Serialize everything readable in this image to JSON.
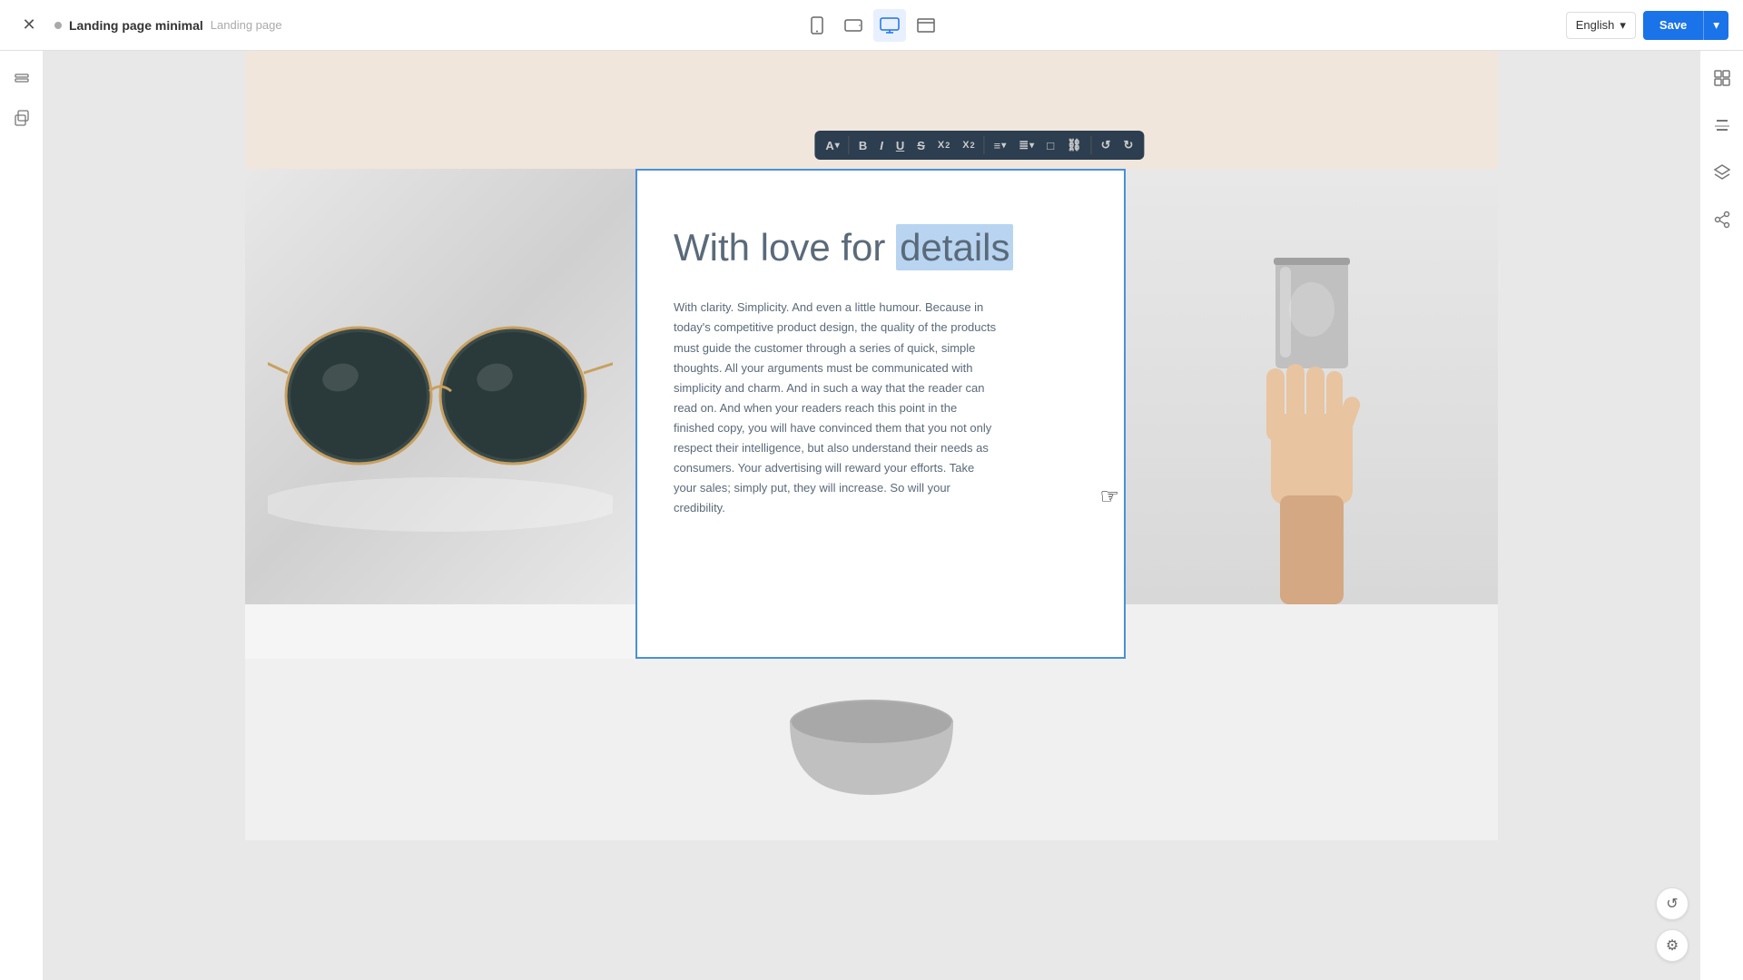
{
  "topbar": {
    "close_label": "✕",
    "page_name": "Landing page minimal",
    "page_type": "Landing page",
    "language": "English",
    "save_label": "Save",
    "devices": [
      {
        "icon": "📱",
        "label": "mobile",
        "active": false
      },
      {
        "icon": "💻",
        "label": "tablet",
        "active": false
      },
      {
        "icon": "🖥",
        "label": "desktop",
        "active": true
      },
      {
        "icon": "⊞",
        "label": "fullscreen",
        "active": false
      }
    ]
  },
  "sidebar_left": {
    "icons": [
      {
        "name": "layers-icon",
        "symbol": "⊞"
      },
      {
        "name": "copy-icon",
        "symbol": "⧉"
      }
    ]
  },
  "sidebar_right": {
    "icons": [
      {
        "name": "element-icon",
        "symbol": "◻"
      },
      {
        "name": "edit-icon",
        "symbol": "✏"
      },
      {
        "name": "layers-icon",
        "symbol": "≡"
      },
      {
        "name": "share-icon",
        "symbol": "⬡"
      }
    ]
  },
  "editor": {
    "heading": "With love for ",
    "heading_highlight": "details",
    "body_text": "With clarity. Simplicity. And even a little humour. Because in today's competitive product design, the quality of the products must guide the customer through a series of quick, simple thoughts. All your arguments must be communicated with simplicity and charm. And in such a way that the reader can read on. And when your readers reach this point in the finished copy, you will have convinced them that you not only respect their intelligence, but also understand their needs as consumers. Your advertising will reward your efforts. Take your sales; simply put, they will increase. So will your credibility."
  },
  "toolbar": {
    "font_label": "A",
    "bold_label": "B",
    "italic_label": "I",
    "underline_label": "U",
    "strikethrough_label": "S̶",
    "superscript_label": "X²",
    "subscript_label": "X₂",
    "align_label": "≡",
    "list_label": "≣",
    "box_label": "□",
    "link_label": "⌘",
    "undo_label": "↺",
    "redo_label": "↻"
  },
  "corner_buttons": {
    "settings_label": "✦",
    "replace_label": "⟳"
  },
  "bottom_controls": {
    "undo_label": "↺",
    "settings_label": "⚙"
  }
}
